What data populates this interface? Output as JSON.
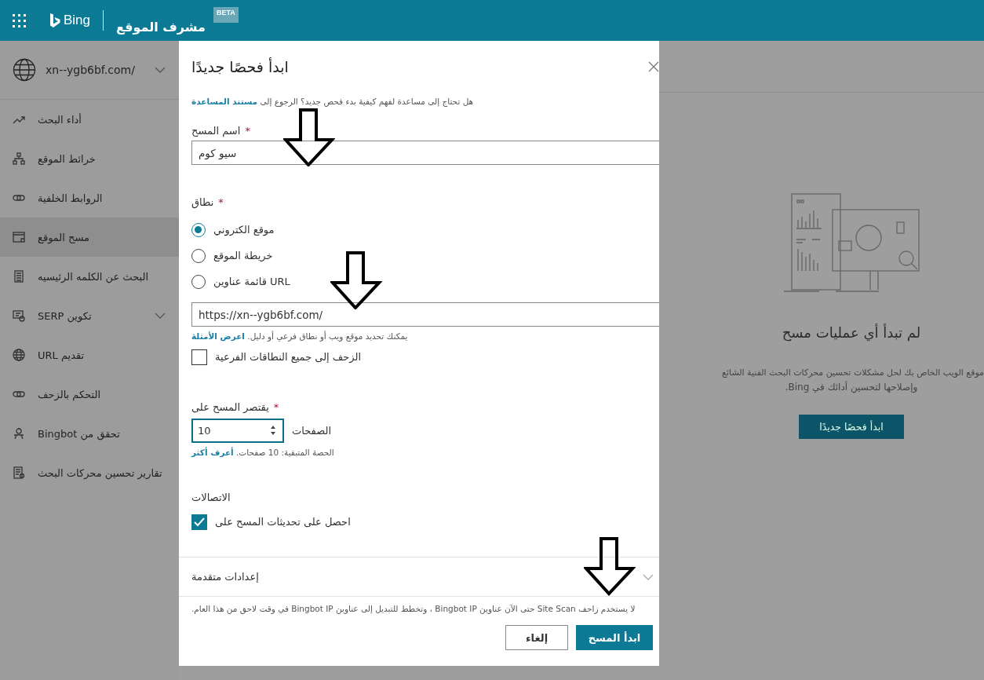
{
  "topbar": {
    "brand": "Bing",
    "title": "مشرف الموقع",
    "badge": "BETA"
  },
  "sidebar": {
    "site": "xn--ygb6bf.com/",
    "items": [
      {
        "label": "أداء البحث",
        "selected": false,
        "expandable": false
      },
      {
        "label": "خرائط الموقع",
        "selected": false,
        "expandable": false
      },
      {
        "label": "الروابط الخلفية",
        "selected": false,
        "expandable": false
      },
      {
        "label": "مسح الموقع",
        "selected": true,
        "expandable": false
      },
      {
        "label": "البحث عن الكلمه الرئيسيه",
        "selected": false,
        "expandable": false
      },
      {
        "label": "تكوين SERP",
        "selected": false,
        "expandable": true
      },
      {
        "label": "تقديم URL",
        "selected": false,
        "expandable": false
      },
      {
        "label": "التحكم بالزحف",
        "selected": false,
        "expandable": false
      },
      {
        "label": "تحقق من Bingbot",
        "selected": false,
        "expandable": false
      },
      {
        "label": "تقارير تحسين محركات البحث",
        "selected": false,
        "expandable": false
      }
    ]
  },
  "panel": {
    "heading": "لم تبدأ أي عمليات مسح",
    "text_lines": [
      "موقع الويب الخاص بك لحل مشكلات تحسين محركات البحث الفنية الشائع",
      "وإصلاحها لتحسين أدائك في Bing."
    ],
    "button": "ابدأ فحصًا جديدًا"
  },
  "dialog": {
    "title": "ابدأ فحصًا جديدًا",
    "help": {
      "text": "هل تحتاج إلى مساعدة لفهم كيفية بدء فحص جديد؟ الرجوع إلى ",
      "link": "مستند المساعدة"
    },
    "name_field": {
      "label": "اسم المسح",
      "mark": "*",
      "value": "سيو كوم"
    },
    "scope": {
      "label": "نطاق",
      "mark": "*",
      "options": [
        {
          "label": "موقع الكتروني",
          "selected": true
        },
        {
          "label": "خريطة الموقع",
          "selected": false
        },
        {
          "label": "URL قائمة عناوين",
          "selected": false
        }
      ],
      "url": "https://xn--ygb6bf.com/",
      "hint": {
        "text": "يمكنك تحديد موقع ويب أو نطاق فرعي أو دليل. ",
        "link": "اعرض الأمثلة"
      },
      "subdomains": {
        "label": "الزحف إلى جميع النطاقات الفرعية",
        "checked": false
      }
    },
    "limit": {
      "label": "يقتصر المسح على",
      "mark": "*",
      "value": "10",
      "unit": "الصفحات",
      "quota": {
        "text": "الحصة المتبقية: 10 صفحات. ",
        "link": "أعرف أكثر"
      }
    },
    "notifications": {
      "label": "الاتصالات",
      "option": {
        "label": "احصل على تحديثات المسح على",
        "checked": true
      }
    },
    "advanced": {
      "label": "إعدادات متقدمة",
      "expanded": false
    },
    "note": "لا يستخدم زاحف Site Scan حتى الآن عناوين Bingbot IP ، وتخطط للتبديل إلى عناوين Bingbot IP في وقت لاحق من هذا العام.",
    "buttons": [
      {
        "label": "ابدأ المسح",
        "kind": "primary"
      },
      {
        "label": "إلغاء",
        "kind": "secondary"
      }
    ]
  }
}
